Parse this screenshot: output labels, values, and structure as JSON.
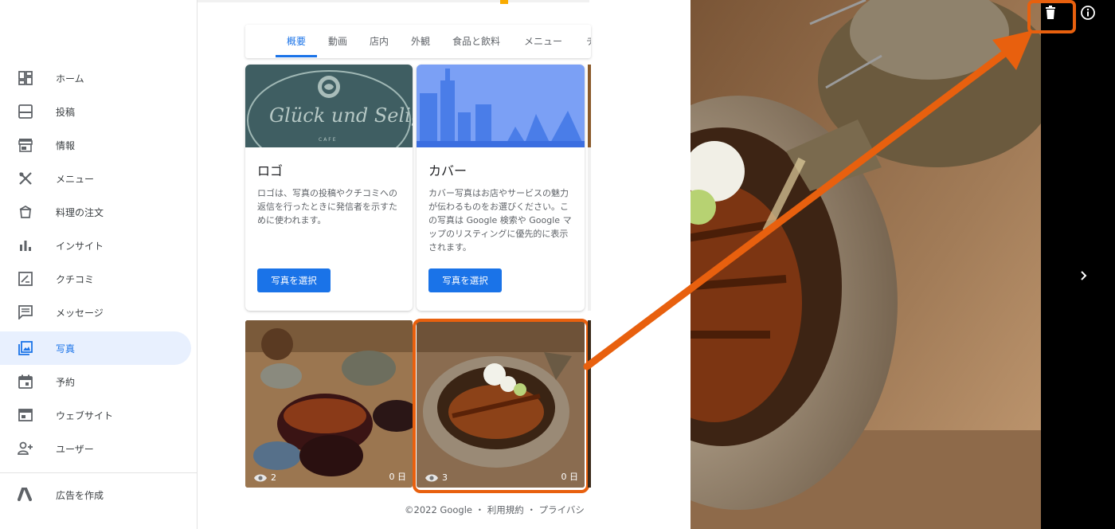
{
  "sidebar": {
    "items": [
      {
        "label": "ホーム",
        "icon": "dashboard-icon"
      },
      {
        "label": "投稿",
        "icon": "post-icon"
      },
      {
        "label": "情報",
        "icon": "storefront-icon"
      },
      {
        "label": "メニュー",
        "icon": "utensils-icon"
      },
      {
        "label": "料理の注文",
        "icon": "food-order-icon"
      },
      {
        "label": "インサイト",
        "icon": "bar-chart-icon"
      },
      {
        "label": "クチコミ",
        "icon": "review-icon"
      },
      {
        "label": "メッセージ",
        "icon": "message-icon"
      },
      {
        "label": "写真",
        "icon": "photo-icon",
        "active": true
      },
      {
        "label": "予約",
        "icon": "calendar-icon"
      },
      {
        "label": "ウェブサイト",
        "icon": "website-icon"
      },
      {
        "label": "ユーザー",
        "icon": "add-user-icon"
      }
    ],
    "ads": {
      "label": "広告を作成",
      "icon": "google-ads-icon"
    }
  },
  "tabs": [
    {
      "label": "概要",
      "active": true
    },
    {
      "label": "動画"
    },
    {
      "label": "店内"
    },
    {
      "label": "外観"
    },
    {
      "label": "食品と飲料"
    },
    {
      "label": "メニュー"
    },
    {
      "label": "チ"
    }
  ],
  "cards": {
    "logo": {
      "title": "ロゴ",
      "desc": "ロゴは、写真の投稿やクチコミへの返信を行ったときに発信者を示すために使われます。",
      "button": "写真を選択",
      "brand_text": "Glück und Selig",
      "brand_sub": "CAFE"
    },
    "cover": {
      "title": "カバー",
      "desc": "カバー写真はお店やサービスの魅力が伝わるものをお選びください。この写真は Google 検索や Google マップのリスティングに優先的に表示されます。",
      "button": "写真を選択"
    }
  },
  "photos": [
    {
      "views": "2",
      "age": "0 日"
    },
    {
      "views": "3",
      "age": "0 日"
    }
  ],
  "footer": {
    "text": "©2022 Google ・ 利用規約 ・ プライバシ"
  },
  "colors": {
    "accent": "#1a73e8",
    "annotation": "#e8600e",
    "active_bg": "#e8f0fe"
  }
}
